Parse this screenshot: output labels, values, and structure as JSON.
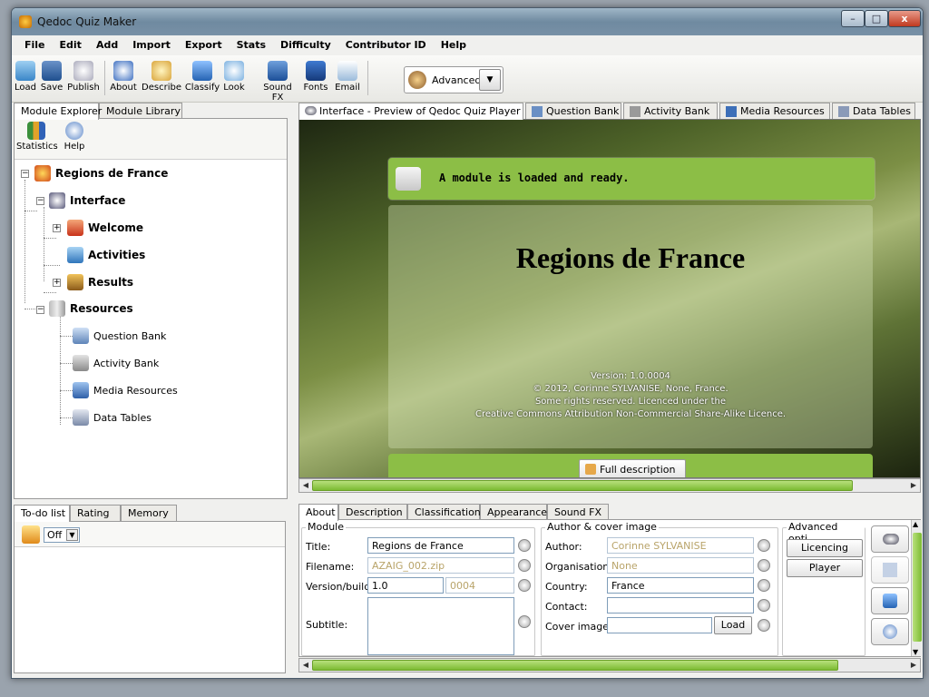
{
  "window": {
    "title": "Qedoc Quiz Maker",
    "minimize": "–",
    "maximize": "□",
    "close": "x"
  },
  "menu": [
    "File",
    "Edit",
    "Add",
    "Import",
    "Export",
    "Stats",
    "Difficulty",
    "Contributor ID",
    "Help"
  ],
  "toolbar": {
    "buttons": [
      {
        "label": "Load",
        "icon": "folder-icon"
      },
      {
        "label": "Save",
        "icon": "floppy-icon"
      },
      {
        "label": "Publish",
        "icon": "publish-icon"
      },
      {
        "label": "About",
        "icon": "info-icon"
      },
      {
        "label": "Describe",
        "icon": "magnifier-icon"
      },
      {
        "label": "Classify",
        "icon": "database-icon"
      },
      {
        "label": "Look",
        "icon": "abc-icon"
      },
      {
        "label": "Sound FX",
        "icon": "music-note-icon"
      },
      {
        "label": "Fonts",
        "icon": "fonts-icon"
      },
      {
        "label": "Email",
        "icon": "email-icon"
      }
    ],
    "mode": "Advanced"
  },
  "left_tabs": [
    "Module Explorer",
    "Module Library"
  ],
  "left_tools": [
    "Statistics",
    "Help"
  ],
  "tree": {
    "root": "Regions de France",
    "interface": "Interface",
    "welcome": "Welcome",
    "activities": "Activities",
    "results": "Results",
    "resources": "Resources",
    "question_bank": "Question Bank",
    "activity_bank": "Activity Bank",
    "media_resources": "Media Resources",
    "data_tables": "Data Tables"
  },
  "bottom_left": {
    "tabs": [
      "To-do list",
      "Rating",
      "Memory"
    ],
    "toggle": "Off"
  },
  "main_tabs": [
    "Interface - Preview of Qedoc Quiz Player",
    "Question Bank",
    "Activity Bank",
    "Media Resources",
    "Data Tables"
  ],
  "preview": {
    "status": "A module is loaded and ready.",
    "heading": "Regions de France",
    "version": "Version: 1.0.0004",
    "copyright": "© 2012, Corinne SYLVANISE, None, France.",
    "rights": "Some rights reserved. Licenced under the",
    "licence": "Creative Commons Attribution Non-Commercial Share-Alike Licence.",
    "full_description": "Full description"
  },
  "prop_tabs": [
    "About",
    "Description",
    "Classification",
    "Appearance",
    "Sound FX"
  ],
  "module": {
    "group": "Module",
    "title_label": "Title:",
    "title": "Regions de France",
    "filename_label": "Filename:",
    "filename": "AZAIG_002.zip",
    "version_label": "Version/build:",
    "version": "1.0",
    "build": "0004",
    "subtitle_label": "Subtitle:",
    "subtitle": ""
  },
  "author": {
    "group": "Author & cover image",
    "author_label": "Author:",
    "author": "Corinne SYLVANISE",
    "org_label": "Organisation:",
    "organisation": "None",
    "country_label": "Country:",
    "country": "France",
    "contact_label": "Contact:",
    "contact": "",
    "cover_label": "Cover image:",
    "cover": "",
    "load": "Load"
  },
  "advanced": {
    "group": "Advanced opti...",
    "licencing": "Licencing",
    "player": "Player"
  }
}
